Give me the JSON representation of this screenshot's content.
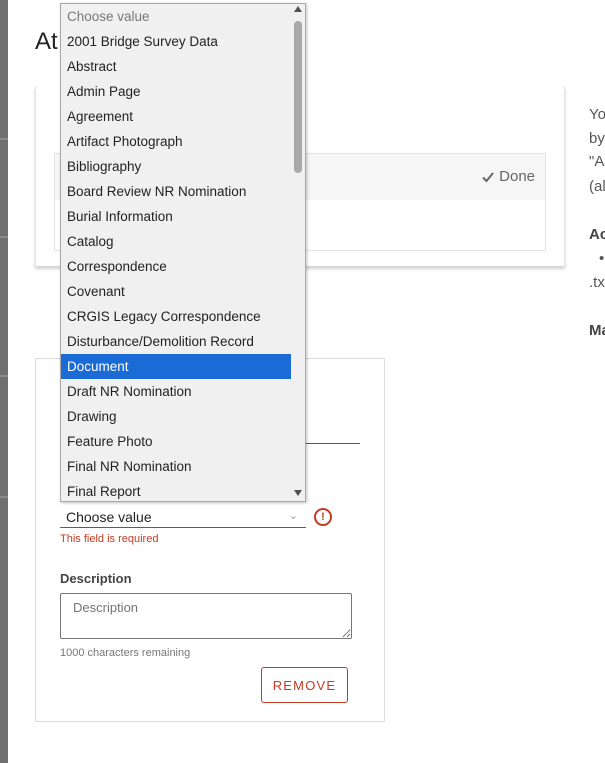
{
  "modal": {
    "title_fragment": "At"
  },
  "file_row": {
    "done_label": "Done"
  },
  "right_column": {
    "line1": "Yo",
    "line2": "by",
    "line3": "\"A",
    "line4": "(al",
    "heading1": "Ac",
    "bullet": "•",
    "ext": ".tx",
    "heading2": "Ma"
  },
  "form": {
    "select_value": "Choose value",
    "error_text": "This field is required",
    "description_label": "Description",
    "description_placeholder": "Description",
    "chars_remaining": "1000 characters remaining",
    "remove_label": "REMOVE"
  },
  "dropdown": {
    "placeholder": "Choose value",
    "selected_index": 14,
    "options": [
      "Choose value",
      "2001 Bridge Survey Data",
      "Abstract",
      "Admin Page",
      "Agreement",
      "Artifact Photograph",
      "Bibliography",
      "Board Review NR Nomination",
      "Burial Information",
      "Catalog",
      "Correspondence",
      "Covenant",
      "CRGIS Legacy Correspondence",
      "Disturbance/Demolition Record",
      "Document",
      "Draft NR Nomination",
      "Drawing",
      "Feature Photo",
      "Final NR Nomination",
      "Final Report"
    ]
  },
  "colors": {
    "accent": "#1a6bd6",
    "error": "#c23b22"
  }
}
